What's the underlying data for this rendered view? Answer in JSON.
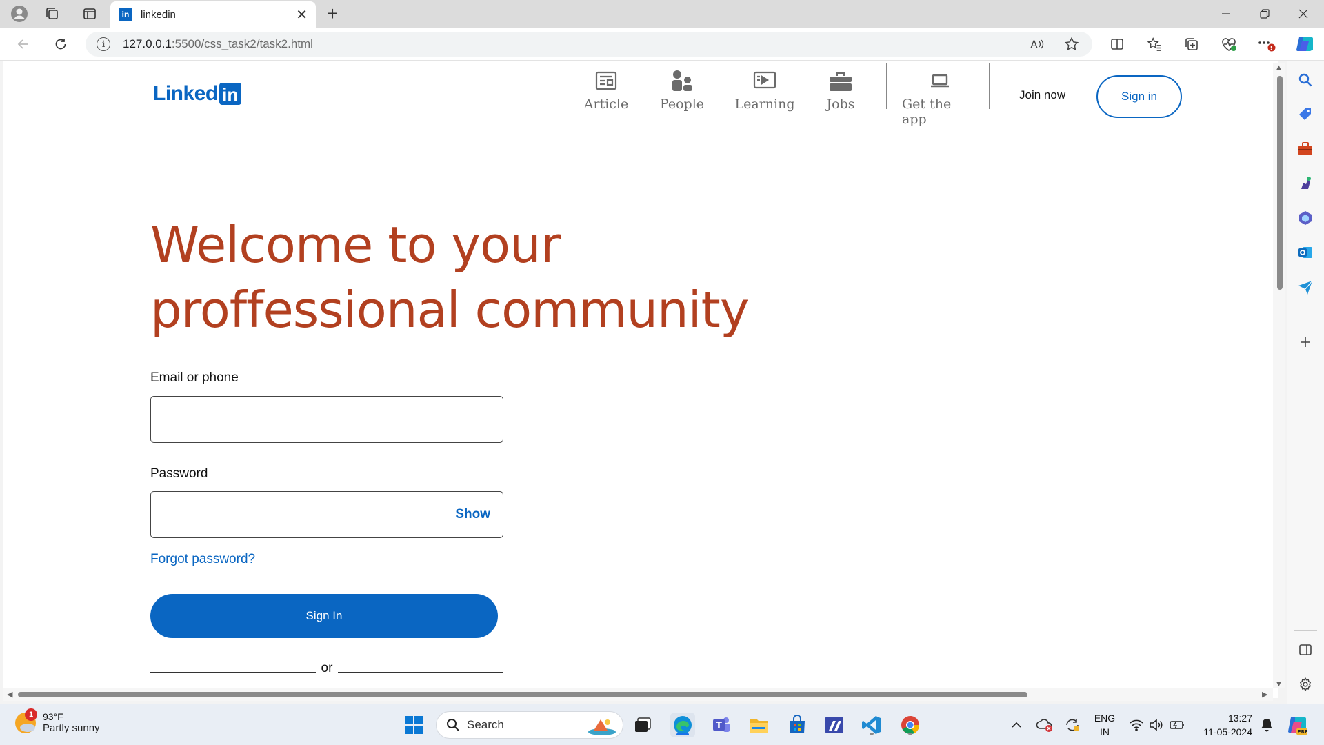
{
  "browser": {
    "tab_title": "linkedin",
    "tab_favicon": "in",
    "url_host": "127.0.0.1",
    "url_rest": ":5500/css_task2/task2.html"
  },
  "page": {
    "logo_word": "Linked",
    "logo_in": "in",
    "nav": {
      "article": "Article",
      "people": "People",
      "learning": "Learning",
      "jobs": "Jobs",
      "get_app": "Get the app"
    },
    "join_now": "Join now",
    "sign_in_top": "Sign in",
    "hero_line1": "Welcome to your",
    "hero_line2": "proffessional community",
    "email_label": "Email or phone",
    "email_value": "",
    "password_label": "Password",
    "password_value": "",
    "show_label": "Show",
    "forgot_label": "Forgot password?",
    "sign_in_main": "Sign In",
    "or_label": "or"
  },
  "taskbar": {
    "weather_badge": "1",
    "temperature": "93°F",
    "weather_desc": "Partly sunny",
    "search_label": "Search",
    "lang_1": "ENG",
    "lang_2": "IN",
    "time": "13:27",
    "date": "11-05-2024"
  },
  "colors": {
    "linkedin_blue": "#0a66c2",
    "hero_orange": "#b24020"
  }
}
